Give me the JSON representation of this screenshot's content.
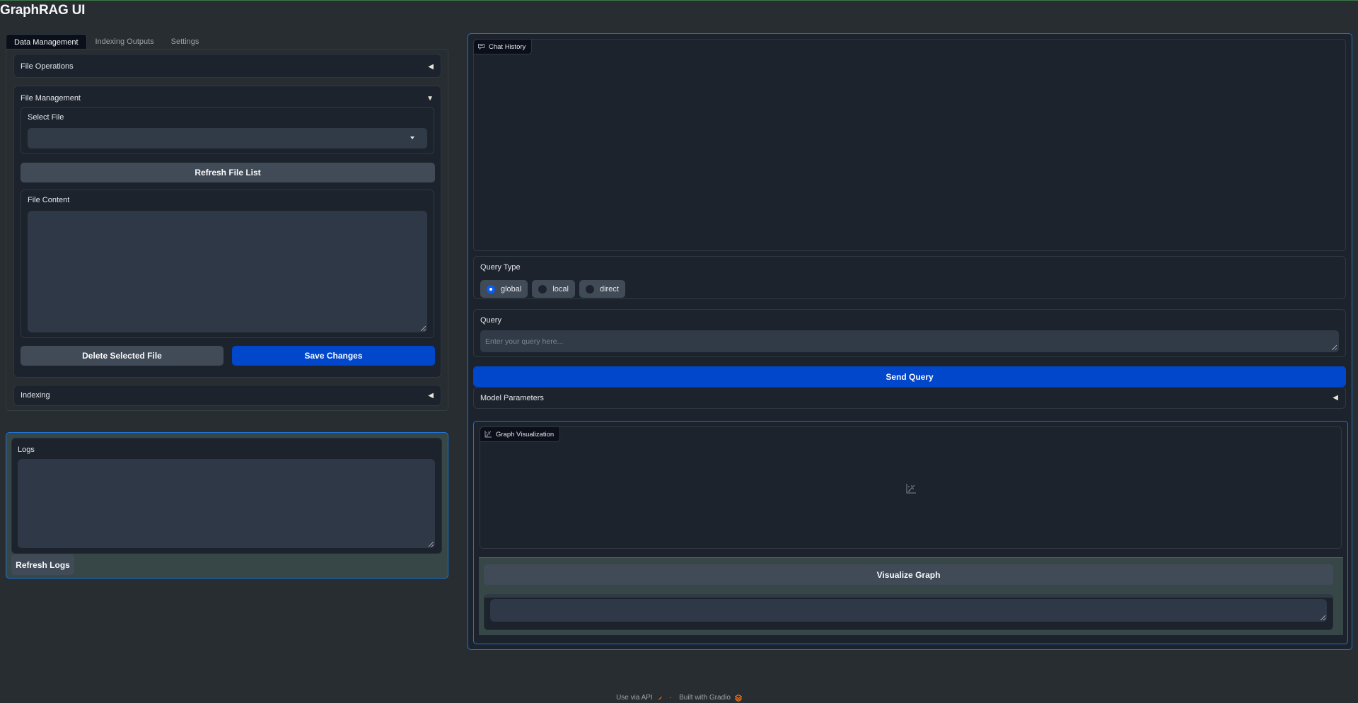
{
  "app": {
    "title": "GraphRAG UI"
  },
  "tabs": [
    {
      "label": "Data Management",
      "active": true
    },
    {
      "label": "Indexing Outputs",
      "active": false
    },
    {
      "label": "Settings",
      "active": false
    }
  ],
  "data_management": {
    "file_operations": {
      "label": "File Operations",
      "state": "collapsed"
    },
    "file_management": {
      "label": "File Management",
      "state": "expanded",
      "select_file": {
        "label": "Select File",
        "value": ""
      },
      "refresh_button": "Refresh File List",
      "file_content": {
        "label": "File Content",
        "value": ""
      },
      "delete_button": "Delete Selected File",
      "save_button": "Save Changes"
    },
    "indexing": {
      "label": "Indexing",
      "state": "collapsed"
    }
  },
  "logs": {
    "label": "Logs",
    "value": "",
    "refresh_button": "Refresh Logs"
  },
  "chat": {
    "history_label": "Chat History",
    "query_type": {
      "label": "Query Type",
      "options": [
        {
          "label": "global",
          "checked": true
        },
        {
          "label": "local",
          "checked": false
        },
        {
          "label": "direct",
          "checked": false
        }
      ]
    },
    "query": {
      "label": "Query",
      "placeholder": "Enter your query here...",
      "value": ""
    },
    "send_button": "Send Query",
    "model_parameters": {
      "label": "Model Parameters",
      "state": "collapsed"
    }
  },
  "graph": {
    "label": "Graph Visualization",
    "visualize_button": "Visualize Graph",
    "output_value": ""
  },
  "footer": {
    "api_link": "Use via API",
    "separator": "·",
    "built_with": "Built with Gradio"
  },
  "colors": {
    "primary": "#0047cc",
    "focus_border": "#1e74d6",
    "accent_orange": "#f97316"
  }
}
